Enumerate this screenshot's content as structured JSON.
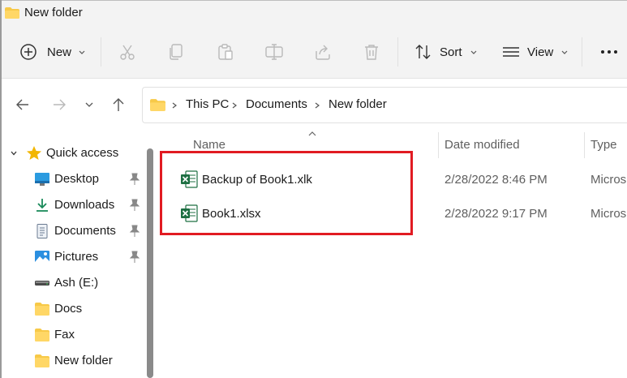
{
  "window": {
    "title": "New folder"
  },
  "toolbar": {
    "new_label": "New",
    "sort_label": "Sort",
    "view_label": "View",
    "icons": [
      "plus-circle-icon",
      "cut-icon",
      "copy-icon",
      "paste-icon",
      "rename-icon",
      "share-icon",
      "delete-icon",
      "sort-icon",
      "view-icon",
      "more-icon"
    ]
  },
  "address": {
    "crumbs": [
      "This PC",
      "Documents",
      "New folder"
    ]
  },
  "sidebar": {
    "items": [
      {
        "label": "Quick access",
        "icon": "star-icon",
        "pinned": false
      },
      {
        "label": "Desktop",
        "icon": "desktop-icon",
        "pinned": true
      },
      {
        "label": "Downloads",
        "icon": "download-icon",
        "pinned": true
      },
      {
        "label": "Documents",
        "icon": "document-icon",
        "pinned": true
      },
      {
        "label": "Pictures",
        "icon": "pictures-icon",
        "pinned": true
      },
      {
        "label": "Ash (E:)",
        "icon": "drive-icon",
        "pinned": false
      },
      {
        "label": "Docs",
        "icon": "folder-icon",
        "pinned": false
      },
      {
        "label": "Fax",
        "icon": "folder-icon",
        "pinned": false
      },
      {
        "label": "New folder",
        "icon": "folder-icon",
        "pinned": false
      }
    ]
  },
  "columns": {
    "name": "Name",
    "date": "Date modified",
    "type": "Type"
  },
  "files": [
    {
      "name": "Backup of Book1.xlk",
      "date": "2/28/2022 8:46 PM",
      "type": "Micros"
    },
    {
      "name": "Book1.xlsx",
      "date": "2/28/2022 9:17 PM",
      "type": "Micros"
    }
  ],
  "colors": {
    "highlight": "#e11b22",
    "folder": "#f7c948",
    "excel": "#1d6f42",
    "star": "#f2b600"
  }
}
